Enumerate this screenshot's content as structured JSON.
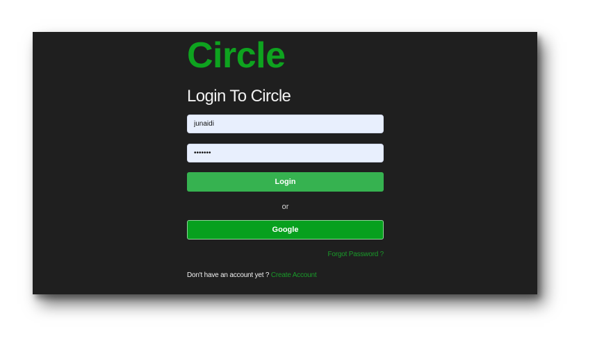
{
  "app": {
    "brand": "Circle"
  },
  "login": {
    "heading": "Login To Circle",
    "username_value": "junaidi",
    "password_value": "•••••••",
    "login_button": "Login",
    "divider": "or",
    "google_button": "Google",
    "forgot_password": "Forgot Password ?",
    "signup_prompt": "Don't have an account yet ?",
    "signup_link": "Create Account"
  },
  "colors": {
    "brand": "#0ea31f",
    "background": "#1f1f1f",
    "login_button": "#36b250",
    "google_button": "#07a01e",
    "link": "#1a9a2a",
    "input_bg": "#e8effd"
  }
}
